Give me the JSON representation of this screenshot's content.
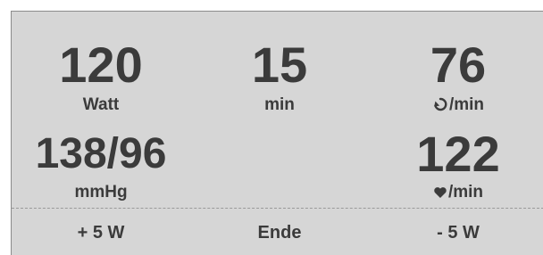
{
  "metrics": {
    "power": {
      "value": "120",
      "unit": "Watt"
    },
    "time": {
      "value": "15",
      "unit": "min"
    },
    "cadence": {
      "value": "76",
      "unit": "/min",
      "icon": "rotation-icon"
    },
    "blood_pressure": {
      "value": "138/96",
      "unit": "mmHg"
    },
    "heart_rate": {
      "value": "122",
      "unit": "/min",
      "icon": "heart-icon"
    }
  },
  "buttons": {
    "increase": "+ 5 W",
    "end": "Ende",
    "decrease": "- 5 W"
  },
  "colors": {
    "panel_bg": "#d6d6d6",
    "text": "#3b3b3b"
  }
}
